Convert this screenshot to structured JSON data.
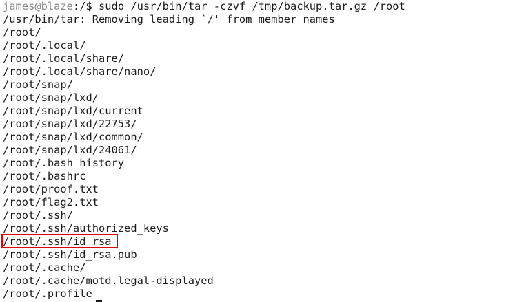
{
  "prompt": {
    "user_host": "james@blaze",
    "path_suffix": ":/$ ",
    "command": "sudo /usr/bin/tar -czvf /tmp/backup.tar.gz /root"
  },
  "output_lines": [
    "/usr/bin/tar: Removing leading `/' from member names",
    "/root/",
    "/root/.local/",
    "/root/.local/share/",
    "/root/.local/share/nano/",
    "/root/snap/",
    "/root/snap/lxd/",
    "/root/snap/lxd/current",
    "/root/snap/lxd/22753/",
    "/root/snap/lxd/common/",
    "/root/snap/lxd/24061/",
    "/root/.bash_history",
    "/root/.bashrc",
    "/root/proof.txt",
    "/root/flag2.txt",
    "/root/.ssh/",
    "/root/.ssh/authorized_keys",
    "/root/.ssh/id_rsa",
    "/root/.ssh/id_rsa.pub",
    "/root/.cache/",
    "/root/.cache/motd.legal-displayed",
    "/root/.profile"
  ],
  "colors": {
    "highlight": "#e00000",
    "prompt_user": "#8a8a8a",
    "text": "#1b1b1b",
    "background": "#ffffff"
  }
}
